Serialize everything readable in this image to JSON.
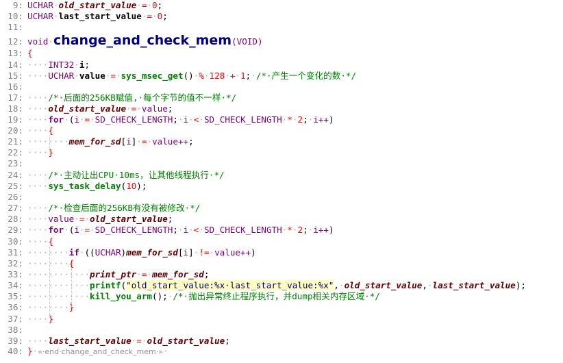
{
  "editor": {
    "lines": [
      {
        "num": "9:",
        "segs": [
          [
            "ty",
            "UCHAR"
          ],
          [
            "sp",
            "·"
          ],
          [
            "gv",
            "old_start_value"
          ],
          [
            "sp",
            "·"
          ],
          [
            "op",
            "="
          ],
          [
            "sp",
            "·"
          ],
          [
            "num",
            "0"
          ],
          [
            "plain",
            ";"
          ]
        ]
      },
      {
        "num": "10:",
        "segs": [
          [
            "ty",
            "UCHAR"
          ],
          [
            "sp",
            "·"
          ],
          [
            "id",
            "last_start_value"
          ],
          [
            "sp",
            "·"
          ],
          [
            "op",
            "="
          ],
          [
            "sp",
            "·"
          ],
          [
            "num",
            "0"
          ],
          [
            "plain",
            ";"
          ]
        ]
      },
      {
        "num": "11:",
        "segs": []
      },
      {
        "num": "12:",
        "segs": [
          [
            "ty",
            "void"
          ],
          [
            "sp",
            "·"
          ],
          [
            "fnbig",
            "change_and_check_mem"
          ],
          [
            "ty",
            "(VOID)"
          ]
        ]
      },
      {
        "num": "13:",
        "segs": [
          [
            "brace",
            "{"
          ]
        ]
      },
      {
        "num": "14:",
        "segs": [
          [
            "sp",
            "····"
          ],
          [
            "ty",
            "INT32"
          ],
          [
            "sp",
            "·"
          ],
          [
            "id",
            "i"
          ],
          [
            "plain",
            ";"
          ]
        ]
      },
      {
        "num": "15:",
        "segs": [
          [
            "sp",
            "····"
          ],
          [
            "ty",
            "UCHAR"
          ],
          [
            "sp",
            "·"
          ],
          [
            "id",
            "value"
          ],
          [
            "sp",
            "·"
          ],
          [
            "op",
            "="
          ],
          [
            "sp",
            "·"
          ],
          [
            "fn",
            "sys_msec_get"
          ],
          [
            "plain",
            "()"
          ],
          [
            "sp",
            "·"
          ],
          [
            "op",
            "%"
          ],
          [
            "sp",
            "·"
          ],
          [
            "num",
            "128"
          ],
          [
            "sp",
            "·"
          ],
          [
            "op",
            "+"
          ],
          [
            "sp",
            "·"
          ],
          [
            "num",
            "1"
          ],
          [
            "plain",
            ";"
          ],
          [
            "sp",
            "·"
          ],
          [
            "cm",
            "/*·产生一个变化的数·*/"
          ]
        ]
      },
      {
        "num": "16:",
        "segs": []
      },
      {
        "num": "17:",
        "segs": [
          [
            "sp",
            "····"
          ],
          [
            "cm",
            "/*·后面的256KB赋值,·每个字节的值不一样·*/"
          ]
        ]
      },
      {
        "num": "18:",
        "segs": [
          [
            "sp",
            "····"
          ],
          [
            "gv",
            "old_start_value"
          ],
          [
            "sp",
            "·"
          ],
          [
            "op",
            "="
          ],
          [
            "sp",
            "·"
          ],
          [
            "mac",
            "value"
          ],
          [
            "plain",
            ";"
          ]
        ]
      },
      {
        "num": "19:",
        "segs": [
          [
            "sp",
            "····"
          ],
          [
            "kw",
            "for"
          ],
          [
            "sp",
            "·"
          ],
          [
            "plain",
            "("
          ],
          [
            "mac",
            "i"
          ],
          [
            "sp",
            "·"
          ],
          [
            "op",
            "="
          ],
          [
            "sp",
            "·"
          ],
          [
            "mac",
            "SD_CHECK_LENGTH"
          ],
          [
            "plain",
            ";"
          ],
          [
            "sp",
            "·"
          ],
          [
            "mac",
            "i"
          ],
          [
            "sp",
            "·"
          ],
          [
            "op",
            "<"
          ],
          [
            "sp",
            "·"
          ],
          [
            "mac",
            "SD_CHECK_LENGTH"
          ],
          [
            "sp",
            "·"
          ],
          [
            "op",
            "*"
          ],
          [
            "sp",
            "·"
          ],
          [
            "num",
            "2"
          ],
          [
            "plain",
            ";"
          ],
          [
            "sp",
            "·"
          ],
          [
            "mac",
            "i++"
          ],
          [
            "plain",
            ")"
          ]
        ]
      },
      {
        "num": "20:",
        "segs": [
          [
            "sp",
            "····"
          ],
          [
            "brace",
            "{"
          ]
        ]
      },
      {
        "num": "21:",
        "segs": [
          [
            "sp",
            "········"
          ],
          [
            "gv",
            "mem_for_sd"
          ],
          [
            "plain",
            "["
          ],
          [
            "mac",
            "i"
          ],
          [
            "plain",
            "]"
          ],
          [
            "sp",
            "·"
          ],
          [
            "op",
            "="
          ],
          [
            "sp",
            "·"
          ],
          [
            "mac",
            "value++"
          ],
          [
            "plain",
            ";"
          ]
        ]
      },
      {
        "num": "22:",
        "segs": [
          [
            "sp",
            "····"
          ],
          [
            "brace",
            "}"
          ]
        ]
      },
      {
        "num": "23:",
        "segs": []
      },
      {
        "num": "24:",
        "segs": [
          [
            "sp",
            "····"
          ],
          [
            "cm",
            "/*·主动让出CPU·10ms，让其他线程执行·*/"
          ]
        ]
      },
      {
        "num": "25:",
        "segs": [
          [
            "sp",
            "····"
          ],
          [
            "fn",
            "sys_task_delay"
          ],
          [
            "plain",
            "("
          ],
          [
            "num",
            "10"
          ],
          [
            "plain",
            ");"
          ]
        ]
      },
      {
        "num": "26:",
        "segs": []
      },
      {
        "num": "27:",
        "segs": [
          [
            "sp",
            "····"
          ],
          [
            "cm",
            "/*·检查后面的256KB有没有被修改·*/"
          ]
        ]
      },
      {
        "num": "28:",
        "segs": [
          [
            "sp",
            "····"
          ],
          [
            "mac",
            "value"
          ],
          [
            "sp",
            "·"
          ],
          [
            "op",
            "="
          ],
          [
            "sp",
            "·"
          ],
          [
            "gv",
            "old_start_value"
          ],
          [
            "plain",
            ";"
          ]
        ]
      },
      {
        "num": "29:",
        "segs": [
          [
            "sp",
            "····"
          ],
          [
            "kw",
            "for"
          ],
          [
            "sp",
            "·"
          ],
          [
            "plain",
            "("
          ],
          [
            "mac",
            "i"
          ],
          [
            "sp",
            "·"
          ],
          [
            "op",
            "="
          ],
          [
            "sp",
            "·"
          ],
          [
            "mac",
            "SD_CHECK_LENGTH"
          ],
          [
            "plain",
            ";"
          ],
          [
            "sp",
            "·"
          ],
          [
            "mac",
            "i"
          ],
          [
            "sp",
            "·"
          ],
          [
            "op",
            "<"
          ],
          [
            "sp",
            "·"
          ],
          [
            "mac",
            "SD_CHECK_LENGTH"
          ],
          [
            "sp",
            "·"
          ],
          [
            "op",
            "*"
          ],
          [
            "sp",
            "·"
          ],
          [
            "num",
            "2"
          ],
          [
            "plain",
            ";"
          ],
          [
            "sp",
            "·"
          ],
          [
            "mac",
            "i++"
          ],
          [
            "plain",
            ")"
          ]
        ]
      },
      {
        "num": "30:",
        "segs": [
          [
            "sp",
            "····"
          ],
          [
            "brace",
            "{"
          ]
        ]
      },
      {
        "num": "31:",
        "segs": [
          [
            "sp",
            "········"
          ],
          [
            "kw",
            "if"
          ],
          [
            "sp",
            "·"
          ],
          [
            "plain",
            "(("
          ],
          [
            "ty",
            "UCHAR"
          ],
          [
            "plain",
            ")"
          ],
          [
            "gv",
            "mem_for_sd"
          ],
          [
            "plain",
            "["
          ],
          [
            "mac",
            "i"
          ],
          [
            "plain",
            "]"
          ],
          [
            "sp",
            "·"
          ],
          [
            "op",
            "!="
          ],
          [
            "sp",
            "·"
          ],
          [
            "mac",
            "value++"
          ],
          [
            "plain",
            ")"
          ]
        ]
      },
      {
        "num": "32:",
        "segs": [
          [
            "sp",
            "········"
          ],
          [
            "brace",
            "{"
          ]
        ]
      },
      {
        "num": "33:",
        "segs": [
          [
            "sp",
            "············"
          ],
          [
            "gv",
            "print_ptr"
          ],
          [
            "sp",
            "·"
          ],
          [
            "op",
            "="
          ],
          [
            "sp",
            "·"
          ],
          [
            "gv",
            "mem_for_sd"
          ],
          [
            "plain",
            ";"
          ]
        ]
      },
      {
        "num": "34:",
        "segs": [
          [
            "sp",
            "············"
          ],
          [
            "fn",
            "printf"
          ],
          [
            "plain",
            "("
          ],
          [
            "str",
            "\"old_start_value:%x·last_start_value:%x\""
          ],
          [
            "plain",
            ","
          ],
          [
            "sp",
            "·"
          ],
          [
            "gv",
            "old_start_value"
          ],
          [
            "plain",
            ","
          ],
          [
            "sp",
            "·"
          ],
          [
            "gv",
            "last_start_value"
          ],
          [
            "plain",
            ");"
          ]
        ]
      },
      {
        "num": "35:",
        "segs": [
          [
            "sp",
            "············"
          ],
          [
            "fn",
            "kill_you_arm"
          ],
          [
            "plain",
            "();"
          ],
          [
            "sp",
            "·"
          ],
          [
            "cm",
            "/*·抛出异常终止程序执行，并dump相关内存区域·*/"
          ]
        ]
      },
      {
        "num": "36:",
        "segs": [
          [
            "sp",
            "········"
          ],
          [
            "brace",
            "}"
          ]
        ]
      },
      {
        "num": "37:",
        "segs": [
          [
            "sp",
            "····"
          ],
          [
            "brace",
            "}"
          ]
        ]
      },
      {
        "num": "38:",
        "segs": []
      },
      {
        "num": "39:",
        "segs": [
          [
            "sp",
            "····"
          ],
          [
            "gv",
            "last_start_value"
          ],
          [
            "sp",
            "·"
          ],
          [
            "op",
            "="
          ],
          [
            "sp",
            "·"
          ],
          [
            "gv",
            "old_start_value"
          ],
          [
            "plain",
            ";"
          ]
        ]
      },
      {
        "num": "40:",
        "segs": [
          [
            "brace",
            "}"
          ],
          [
            "sp",
            "·"
          ],
          [
            "endnote",
            "«·end·change_and_check_mem·»"
          ],
          [
            "sp",
            "·"
          ]
        ]
      }
    ]
  }
}
